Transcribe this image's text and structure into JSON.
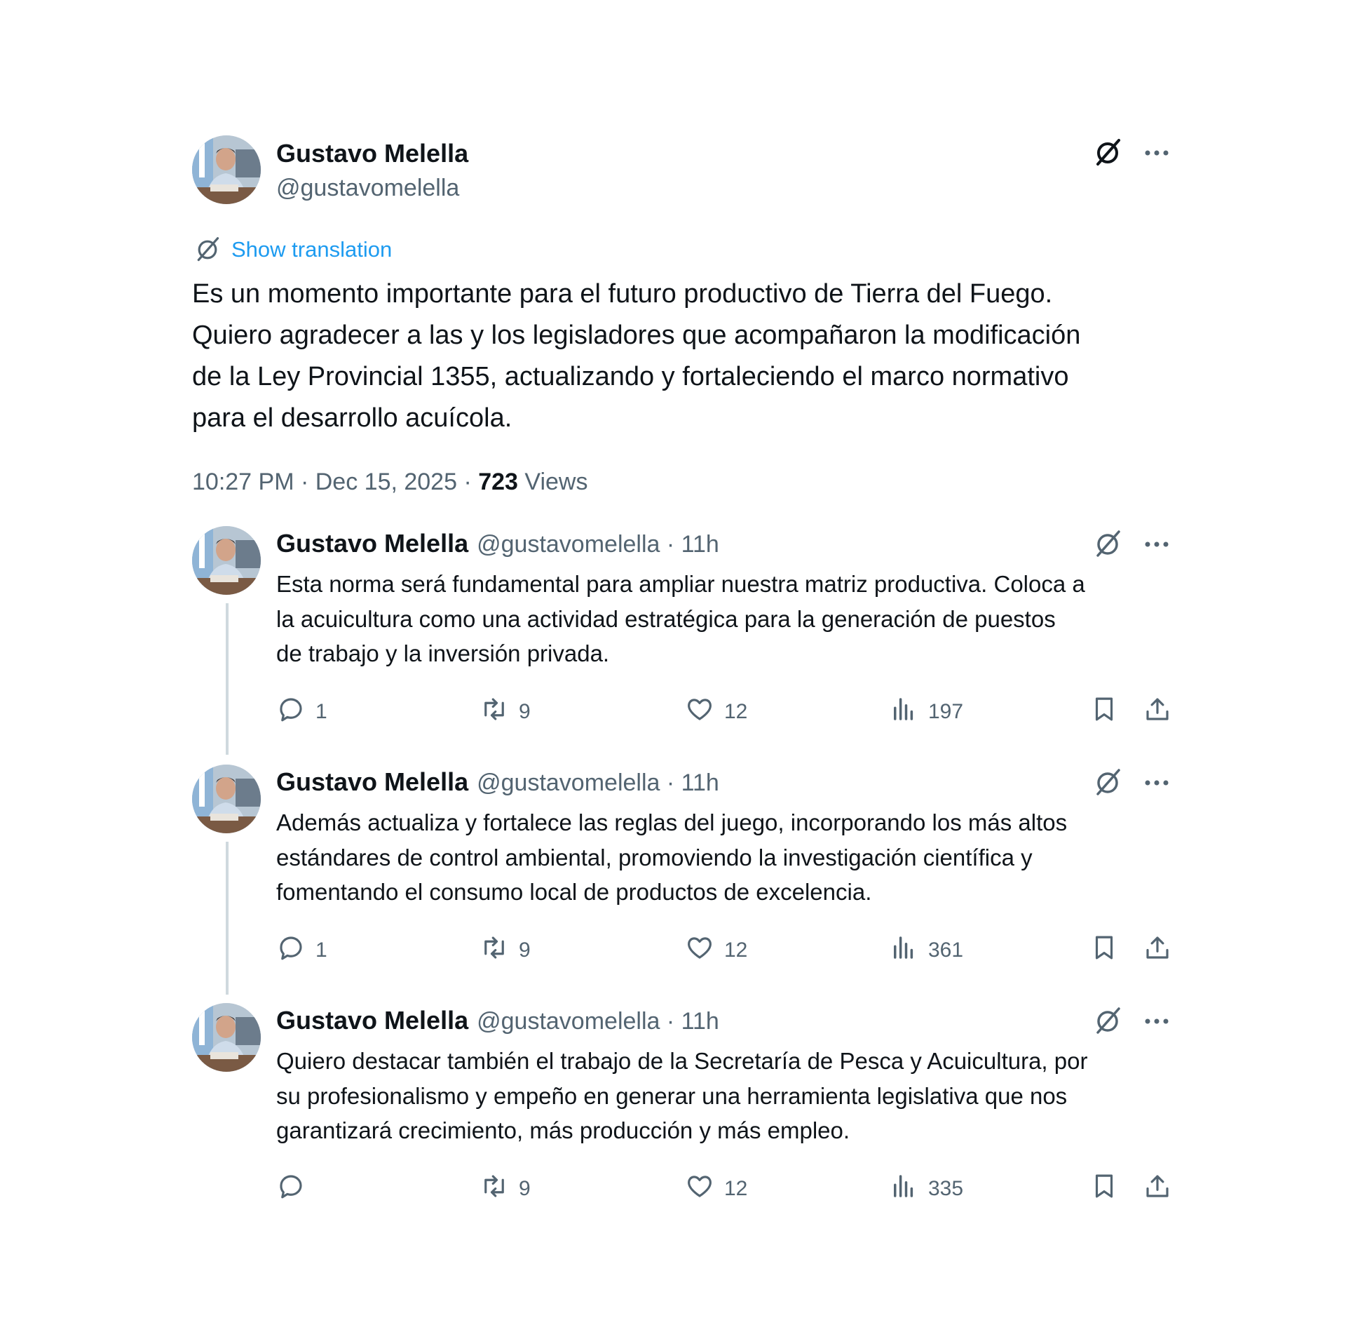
{
  "main_tweet": {
    "author_name": "Gustavo Melella",
    "author_handle": "@gustavomelella",
    "show_translation": "Show translation",
    "lines": [
      "Es un momento importante para el futuro productivo de Tierra del Fuego.",
      "Quiero agradecer a las y los legisladores que acompañaron la modificación",
      "de la Ley Provincial 1355, actualizando y fortaleciendo el marco normativo",
      "para el desarrollo acuícola."
    ],
    "timestamp": "10:27 PM · Dec 15, 2025 · ",
    "views_count": "723",
    "views_label": " Views"
  },
  "replies": [
    {
      "author_name": "Gustavo Melella",
      "author_handle": "@gustavomelella · 11h",
      "lines": [
        "Esta norma será fundamental para ampliar nuestra matriz productiva. Coloca a",
        "la acuicultura como una actividad estratégica para la generación de puestos",
        "de trabajo y la inversión privada."
      ],
      "replies": "1",
      "reposts": "9",
      "likes": "12",
      "views": "197"
    },
    {
      "author_name": "Gustavo Melella",
      "author_handle": "@gustavomelella · 11h",
      "lines": [
        "Además actualiza y fortalece las reglas del juego, incorporando los más altos",
        "estándares de control ambiental, promoviendo la investigación científica y",
        "fomentando el consumo local de productos de excelencia."
      ],
      "replies": "1",
      "reposts": "9",
      "likes": "12",
      "views": "361"
    },
    {
      "author_name": "Gustavo Melella",
      "author_handle": "@gustavomelella · 11h",
      "lines": [
        "Quiero destacar también el trabajo de la Secretaría de Pesca y Acuicultura, por",
        "su profesionalismo y empeño en generar una herramienta legislativa que nos",
        "garantizará crecimiento, más producción y más empleo."
      ],
      "replies": "",
      "reposts": "9",
      "likes": "12",
      "views": "335"
    }
  ],
  "icons": [
    "grok-icon",
    "more-icon",
    "translate-icon",
    "reply-icon",
    "repost-icon",
    "like-icon",
    "views-icon",
    "bookmark-icon",
    "share-icon"
  ],
  "colors": {
    "link": "#1d9bf0",
    "secondary": "#536471",
    "text": "#0f1419",
    "thread_line": "#cfd9de"
  }
}
